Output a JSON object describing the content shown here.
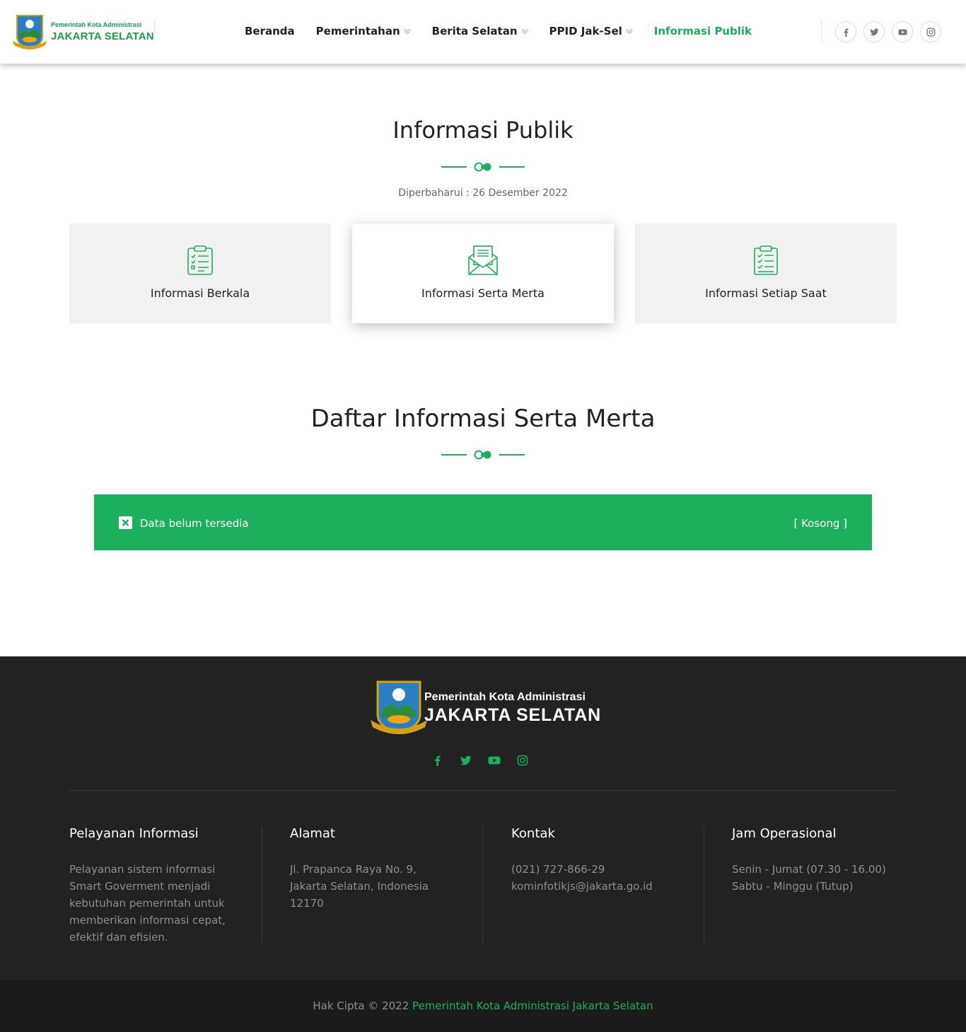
{
  "header": {
    "logo_small": "Pemerintah Kota Administrasi",
    "logo_big": "JAKARTA SELATAN",
    "nav": [
      {
        "label": "Beranda",
        "has_dropdown": false,
        "active": false
      },
      {
        "label": "Pemerintahan",
        "has_dropdown": true,
        "active": false
      },
      {
        "label": "Berita Selatan",
        "has_dropdown": true,
        "active": false
      },
      {
        "label": "PPID Jak-Sel",
        "has_dropdown": true,
        "active": false
      },
      {
        "label": "Informasi Publik",
        "has_dropdown": false,
        "active": true
      }
    ],
    "social_icons": [
      "facebook-icon",
      "twitter-icon",
      "youtube-icon",
      "instagram-icon"
    ]
  },
  "main": {
    "title": "Informasi Publik",
    "updated": "Diperbaharui : 26 Desember 2022",
    "cards": [
      {
        "label": "Informasi Berkala",
        "icon": "clipboard-list-icon",
        "active": false
      },
      {
        "label": "Informasi Serta Merta",
        "icon": "envelope-open-icon",
        "active": true
      },
      {
        "label": "Informasi Setiap Saat",
        "icon": "clipboard-check-icon",
        "active": false
      }
    ],
    "list_title": "Daftar Informasi Serta Merta",
    "alert": {
      "icon": "close-square-icon",
      "text": "Data belum tersedia",
      "status": "[ Kosong ]"
    }
  },
  "footer": {
    "logo_small": "Pemerintah Kota Administrasi",
    "logo_big": "JAKARTA SELATAN",
    "columns": [
      {
        "title": "Pelayanan Informasi",
        "lines": [
          "Pelayanan sistem informasi",
          "Smart Goverment menjadi",
          "kebutuhan pemerintah untuk",
          "memberikan informasi cepat,",
          "efektif dan efisien."
        ]
      },
      {
        "title": "Alamat",
        "lines": [
          "Jl. Prapanca Raya No. 9,",
          "Jakarta Selatan, Indonesia",
          "12170"
        ]
      },
      {
        "title": "Kontak",
        "lines": [
          "(021) 727-866-29",
          "kominfotikjs@jakarta.go.id"
        ]
      },
      {
        "title": "Jam Operasional",
        "lines": [
          "Senin - Jumat (07.30 - 16.00)",
          "Sabtu - Minggu (Tutup)"
        ]
      }
    ],
    "copyright_prefix": "Hak Cipta © 2022",
    "copyright_link": "Pemerintah Kota Administrasi Jakarta Selatan"
  },
  "colors": {
    "accent": "#1caf5d",
    "footer_bg": "#222222",
    "bottom_bg": "#1b1b1b"
  }
}
